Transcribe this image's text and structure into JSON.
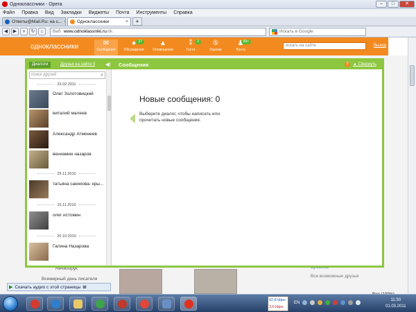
{
  "window": {
    "title": "Одноклассники - Opera"
  },
  "menu": [
    "Файл",
    "Правка",
    "Вид",
    "Закладки",
    "Виджеты",
    "Почта",
    "Инструменты",
    "Справка"
  ],
  "tabs": [
    {
      "label": "Ответы@Mail.Ru: на с...",
      "active": false,
      "color": "#1a5fb4"
    },
    {
      "label": "Одноклассники",
      "active": true,
      "color": "#f38a1f"
    }
  ],
  "address": {
    "web_label": "Веб",
    "host": "www.odnoklassniki.ru",
    "path": "/dk",
    "search_placeholder": "Искать в Google"
  },
  "site": {
    "logo": "одноклассники",
    "nav": [
      {
        "label": "Сообщения",
        "icon": "envelope-icon",
        "badge": ""
      },
      {
        "label": "Обсуждения",
        "icon": "comments-icon",
        "badge": "27"
      },
      {
        "label": "Оповещения",
        "icon": "bell-icon",
        "badge": ""
      },
      {
        "label": "Гости",
        "icon": "footprints-icon",
        "badge": "2"
      },
      {
        "label": "Оценки",
        "icon": "rating-icon",
        "badge": ""
      },
      {
        "label": "Лента",
        "icon": "feed-icon",
        "badge": "99+"
      }
    ],
    "search_placeholder": "искать на сайте",
    "exit": "Выход",
    "bg_left": [
      "Нечипорук",
      "Всемирный день писателя"
    ],
    "bg_right": {
      "name": "Бровина",
      "friends_label": "Все возможные друзья"
    }
  },
  "dialog": {
    "tab_dialogs": "Диалоги",
    "tab_online": "Друзья на сайте 0",
    "title": "Сообщения",
    "collapse": "Свернуть",
    "help": "?",
    "friend_search_placeholder": "поиск друзей",
    "dates": [
      "23.02.2011",
      "25.11.2010",
      "15.11.2010",
      "20.10.2010"
    ],
    "contacts": [
      {
        "name": "Олег Золотовицкий",
        "avatar_color": "#6b7b8c"
      },
      {
        "name": "виталий малеев",
        "avatar_color": "#8c6a4f"
      },
      {
        "name": "Александр Атменеев",
        "avatar_color": "#7a5a3f"
      },
      {
        "name": "вениамин назаров",
        "avatar_color": "#9a8a6a"
      },
      {
        "name": "татьяна саенкова- кры...",
        "avatar_color": "#4a3a2a"
      },
      {
        "name": "олег истомин",
        "avatar_color": "#707070"
      },
      {
        "name": "Галина Назарова",
        "avatar_color": "#b89a7a"
      }
    ],
    "new_messages": "Новые сообщения: 0",
    "hint": "Выберите диалог, чтобы написать или прочитать новые сообщения."
  },
  "status": {
    "download": "Скачать аудио с этой страницы",
    "zoom": "Вид (100%)"
  },
  "taskbar": {
    "speed_up": "92,8 kbps",
    "speed_down": "3,6 kbps",
    "lang": "EN",
    "time": "11:30",
    "date": "01.03.2011"
  }
}
